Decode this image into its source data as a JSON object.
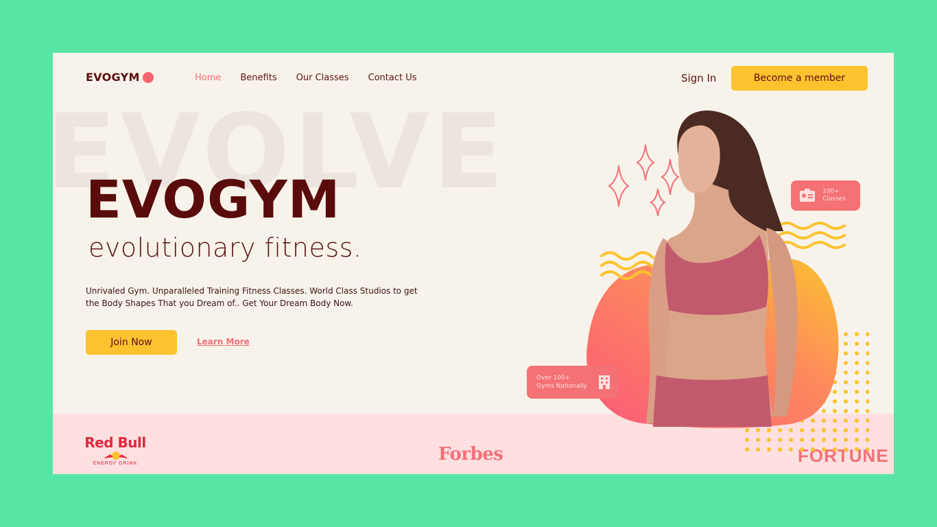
{
  "nav": {
    "logo": "EVOGYM",
    "links": [
      "Home",
      "Benefits",
      "Our Classes",
      "Contact Us"
    ],
    "active": "Home",
    "sign_in": "Sign In",
    "cta": "Become a member"
  },
  "hero": {
    "watermark": "EVOLVE",
    "title": "EVOGYM",
    "subtitle": "evolutionary fitness.",
    "description": "Unrivaled Gym. Unparalleled Training Fitness Classes. World Class Studios to get the Body Shapes That you Dream of.. Get Your Dream Body Now.",
    "join_label": "Join Now",
    "learn_more_label": "Learn More"
  },
  "badges": {
    "classes_line1": "100+",
    "classes_line2": "Classes",
    "gyms_line1": "Over 100+",
    "gyms_line2": "Gyms Nationally"
  },
  "sponsors": {
    "redbull": "Red Bull",
    "redbull_sub": "ENERGY DRINK",
    "forbes": "Forbes",
    "fortune": "FORTUNE"
  },
  "colors": {
    "page_bg": "#57e6a5",
    "frame_bg": "#f8f3ea",
    "brand_dark": "#5a0b0b",
    "accent_pink": "#f2707a",
    "accent_yellow": "#fcc32f",
    "sponsor_band": "#fde0df"
  }
}
